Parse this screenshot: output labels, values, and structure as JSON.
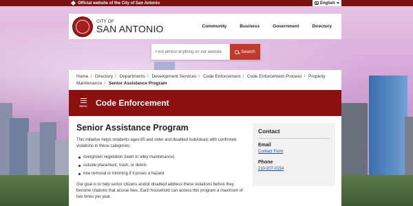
{
  "topbar": {
    "official_text": "Official website of the City of San Antonio",
    "language": "English"
  },
  "header": {
    "brand_small": "CITY OF",
    "brand_big": "SAN ANTONIO",
    "nav": [
      "Community",
      "Business",
      "Government",
      "Directory"
    ]
  },
  "search": {
    "placeholder": "Find almost anything on our website",
    "button_label": "Search"
  },
  "breadcrumb": {
    "items": [
      "Home",
      "Directory",
      "Departments",
      "Development Services",
      "Code Enforcement",
      "Code Enforcement Process",
      "Property Maintenance"
    ],
    "current": "Senior Assistance Program"
  },
  "banner": {
    "menu_label": "Menu",
    "title": "Code Enforcement"
  },
  "main": {
    "heading": "Senior Assistance Program",
    "intro": "This initiative helps residents ages 65 and older and disabled individuals with confirmed violations in these categories:",
    "bullets": [
      "overgrown vegetation (lawn or alley maintenance)",
      "outside placement, trash, or debris",
      "tree removal or trimming if it poses a hazard"
    ],
    "goal": "Our goal is to help senior citizens and/or disabled address these violations before they become citations that accrue fees. Each household can access this program a maximum of two times per year."
  },
  "contact": {
    "heading": "Contact",
    "email_label": "Email",
    "email_link": "Contact Form",
    "phone_label": "Phone",
    "phone": "210-207-0154"
  },
  "colors": {
    "brand_red": "#8b1111",
    "topbar": "#7a1212",
    "search_button": "#c0392b",
    "link": "#1a4d99"
  }
}
